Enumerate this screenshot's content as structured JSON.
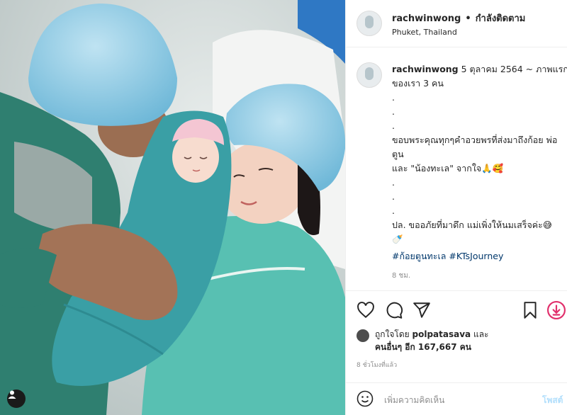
{
  "post": {
    "username": "rachwinwong",
    "separator": "•",
    "follow_status": "กำลังติดตาม",
    "location": "Phuket, Thailand"
  },
  "caption": {
    "username": "rachwinwong",
    "first_line": " 5 ตุลาคม 2564 ~ ภาพแรก",
    "second_line": "ของเรา 3 คน",
    "dot1": ".",
    "dot2": ".",
    "dot3": ".",
    "thanks_line": "ขอบพระคุณทุกๆคำอวยพรที่ส่งมาถึงก้อย พ่อตูน",
    "thanks_line2": "และ \"น้องทะเล\" จากใจ🙏🥰",
    "dot4": ".",
    "dot5": ".",
    "dot6": ".",
    "ps_line": "ปล. ขออภัยที่มาดึก แม่เพิ่งให้นมเสร็จค่ะ😅",
    "ps_line2": "🍼",
    "hashtags": "#ก้อยตูนทะเล #KTsJourney",
    "time": "8 ชม."
  },
  "actions": {
    "like_icon": "heart-icon",
    "comment_icon": "comment-icon",
    "share_icon": "share-icon",
    "save_icon": "bookmark-icon",
    "extra_icon": "download-icon"
  },
  "likes": {
    "prefix": "ถูกใจโดย ",
    "liker": "polpatasava",
    "middle": " และ",
    "others": "คนอื่นๆ อีก 167,667 คน"
  },
  "posted_ago": "8 ชั่วโมงที่แล้ว",
  "comment": {
    "placeholder": "เพิ่มความคิดเห็น",
    "post_label": "โพสต์"
  },
  "colors": {
    "accent_blue": "#0095f6",
    "hashtag": "#00376b",
    "muted": "#8e8e8e"
  }
}
